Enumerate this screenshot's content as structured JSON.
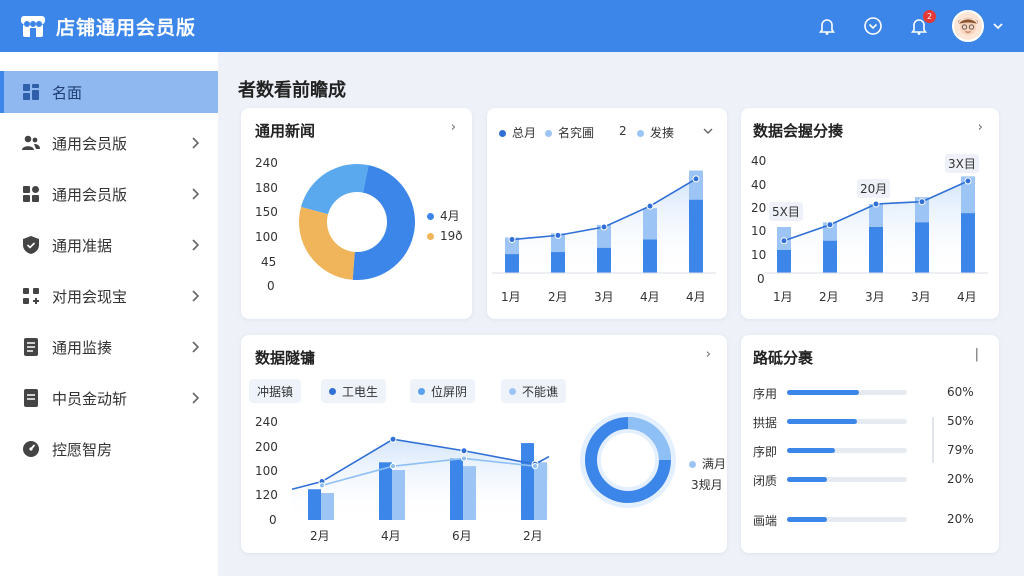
{
  "app": {
    "title": "店铺通用会员版"
  },
  "header": {
    "badge_count": "2",
    "icons": [
      "bell-icon",
      "chevron-circle-icon",
      "notification-icon",
      "avatar",
      "chevron-down-icon"
    ]
  },
  "sidebar": {
    "items": [
      {
        "label": "名面",
        "icon": "dashboard-icon",
        "active": true
      },
      {
        "label": "通用会员版",
        "icon": "users-icon"
      },
      {
        "label": "通用会员版",
        "icon": "grid-icon"
      },
      {
        "label": "通用准据",
        "icon": "shield-icon"
      },
      {
        "label": "对用会现宝",
        "icon": "apps-icon"
      },
      {
        "label": "通用监揍",
        "icon": "doc-icon"
      },
      {
        "label": "中员金动斩",
        "icon": "file-icon"
      },
      {
        "label": "控愿智房",
        "icon": "gauge-icon"
      }
    ]
  },
  "main": {
    "title": "者数看前瞻成"
  },
  "card1": {
    "title": "通用新闻",
    "more": "›",
    "yticks": [
      "240",
      "180",
      "150",
      "100",
      "45",
      "0"
    ],
    "legend": [
      {
        "label": "4月",
        "color": "#3c86ea"
      },
      {
        "label": "19ð",
        "color": "#f0b45a"
      }
    ]
  },
  "card2": {
    "legend": [
      {
        "label": "总月",
        "color": "#2f6fd6"
      },
      {
        "label": "名究圃",
        "color": "#9cc4f5"
      },
      {
        "label": "2",
        "color": "#ffffff"
      },
      {
        "label": "发揍",
        "color": "#9cc4f5"
      }
    ],
    "xticks": [
      "1月",
      "2月",
      "3月",
      "4月",
      "4月"
    ]
  },
  "card3": {
    "title": "数据会握分揍",
    "more": "›",
    "yticks": [
      "40",
      "40",
      "20",
      "10",
      "10",
      "0"
    ],
    "xticks": [
      "1月",
      "2月",
      "3月",
      "3月",
      "4月"
    ],
    "annotations": [
      "5X目",
      "20月",
      "3X目"
    ]
  },
  "card4": {
    "title": "数据隧镛",
    "more": "›",
    "chips": [
      {
        "label": "冲据镇",
        "color": ""
      },
      {
        "label": "工电生",
        "color": "#2f6fd6"
      },
      {
        "label": "位屏阴",
        "color": "#5aa0ee"
      },
      {
        "label": "不能谯",
        "color": "#9cc4f5"
      }
    ],
    "yticks": [
      "240",
      "200",
      "100",
      "120",
      "0"
    ],
    "xticks": [
      "2月",
      "4月",
      "6月",
      "2月"
    ],
    "ring_legend": [
      "满月",
      "3规月"
    ]
  },
  "card5": {
    "title": "路砥分裹",
    "more": "|",
    "rows": [
      {
        "label": "序用",
        "value": "60%",
        "fill": 0.6
      },
      {
        "label": "拱据",
        "value": "50%",
        "fill": 0.58
      },
      {
        "label": "序即",
        "value": "79%",
        "fill": 0.4
      },
      {
        "label": "闭质",
        "value": "20%",
        "fill": 0.33
      },
      {
        "label": "画端",
        "value": "20%",
        "fill": 0.33
      }
    ]
  },
  "chart_data": [
    {
      "type": "pie",
      "slices": [
        {
          "label": "4月",
          "value": 48,
          "color": "#3c86ea"
        },
        {
          "label": "19ð",
          "value": 28,
          "color": "#f0b45a"
        },
        {
          "label": "",
          "value": 24,
          "color": "#5aa8ee"
        }
      ]
    },
    {
      "type": "bar",
      "categories": [
        "1月",
        "2月",
        "3月",
        "4月",
        "4月"
      ],
      "series": [
        {
          "name": "总月",
          "values": [
            9,
            10,
            12,
            16,
            35
          ]
        },
        {
          "name": "名究圃",
          "values": [
            17,
            19,
            23,
            31,
            49
          ]
        },
        {
          "name": "发揍",
          "values": [
            16,
            18,
            22,
            32,
            45
          ]
        }
      ],
      "ylim": [
        0,
        55
      ]
    },
    {
      "type": "bar",
      "categories": [
        "1月",
        "2月",
        "3月",
        "3月",
        "4月"
      ],
      "series": [
        {
          "values": [
            10,
            14,
            20,
            22,
            26
          ]
        },
        {
          "values": [
            20,
            22,
            30,
            33,
            42
          ]
        },
        {
          "values": [
            14,
            21,
            30,
            31,
            40
          ]
        }
      ],
      "ylim": [
        0,
        50
      ]
    },
    {
      "type": "bar",
      "categories": [
        "2月",
        "4月",
        "6月",
        "2月"
      ],
      "series": [
        {
          "name": "工电生",
          "values": [
            80,
            150,
            160,
            200
          ]
        },
        {
          "name": "位屏阴",
          "values": [
            70,
            130,
            140,
            150
          ],
          "line": [
            100,
            210,
            180,
            145
          ]
        },
        {
          "name": "不能谯",
          "values": [
            0,
            0,
            0,
            0
          ],
          "line": [
            90,
            140,
            160,
            140
          ]
        }
      ],
      "ylim": [
        0,
        260
      ]
    },
    {
      "type": "pie",
      "slices": [
        {
          "label": "满月",
          "value": 70
        },
        {
          "label": "3规月",
          "value": 30
        }
      ]
    }
  ]
}
